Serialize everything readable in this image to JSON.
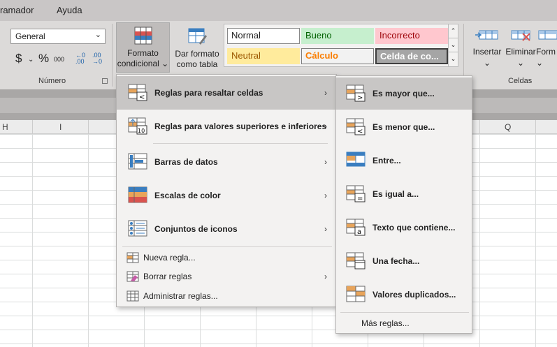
{
  "menubar": {
    "items": [
      "ramador",
      "Ayuda"
    ]
  },
  "ribbon": {
    "number_format": "General",
    "number_group_label": "Número",
    "currency_symbol": "$",
    "percent_symbol": "%",
    "thousands_symbol": "000",
    "decimal_increase": "←0\n.00",
    "decimal_decrease": ".00\n→0",
    "conditional_format_line1": "Formato",
    "conditional_format_line2": "condicional",
    "format_table_line1": "Dar formato",
    "format_table_line2": "como tabla",
    "styles": {
      "normal": "Normal",
      "bueno": "Bueno",
      "incorrecto": "Incorrecto",
      "neutral": "Neutral",
      "calculo": "Cálculo",
      "celda": "Celda de co..."
    },
    "cells_group_label": "Celdas",
    "insert_label": "Insertar",
    "delete_label": "Eliminar",
    "format_label": "Form"
  },
  "columns": [
    "H",
    "I",
    "Q"
  ],
  "cf_menu": {
    "items": [
      {
        "label": "Reglas para resaltar celdas",
        "u": "R"
      },
      {
        "label": "Reglas para valores superiores e inferiores",
        "u": "R"
      },
      {
        "label": "Barras de datos",
        "u": "B"
      },
      {
        "label": "Escalas de color",
        "u": "E"
      },
      {
        "label": "Conjuntos de iconos",
        "u": "C"
      }
    ],
    "small_items": [
      "Nueva regla...",
      "Borrar reglas",
      "Administrar reglas..."
    ]
  },
  "highlight_menu": {
    "items": [
      "Es mayor que...",
      "Es menor que...",
      "Entre...",
      "Es igual a...",
      "Texto que contiene...",
      "Una fecha...",
      "Valores duplicados..."
    ],
    "more": "Más reglas..."
  },
  "colors": {
    "accent_orange": "#e8a45a",
    "accent_blue": "#3a7ec0",
    "accent_red": "#d9534f"
  }
}
